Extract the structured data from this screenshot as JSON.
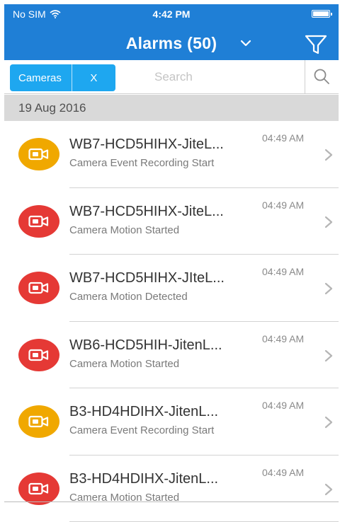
{
  "status_bar": {
    "carrier": "No SIM",
    "wifi_icon": "wifi-icon",
    "time": "4:42 PM",
    "battery_icon": "battery-icon"
  },
  "header": {
    "title": "Alarms (50)",
    "dropdown_icon": "chevron-down-icon",
    "filter_icon": "filter-funnel-icon",
    "background_color": "#1f7fd6"
  },
  "search": {
    "filter_chip_label": "Cameras",
    "filter_chip_clear": "X",
    "placeholder": "Search",
    "value": "",
    "search_icon": "search-icon",
    "chip_color": "#1ea7f0"
  },
  "date_header": "19 Aug 2016",
  "alarms": [
    {
      "title": "WB7-HCD5HIHX-JiteL...",
      "subtitle": "Camera Event Recording Start",
      "time": "04:49 AM",
      "severity": "warning",
      "icon_color": "#f0a800"
    },
    {
      "title": "WB7-HCD5HIHX-JiteL...",
      "subtitle": "Camera Motion Started",
      "time": "04:49 AM",
      "severity": "critical",
      "icon_color": "#e53935"
    },
    {
      "title": "WB7-HCD5HIHX-JIteL...",
      "subtitle": "Camera Motion Detected",
      "time": "04:49 AM",
      "severity": "critical",
      "icon_color": "#e53935"
    },
    {
      "title": "WB6-HCD5HIH-JitenL...",
      "subtitle": "Camera Motion Started",
      "time": "04:49 AM",
      "severity": "critical",
      "icon_color": "#e53935"
    },
    {
      "title": "B3-HD4HDIHX-JitenL...",
      "subtitle": "Camera Event Recording Start",
      "time": "04:49 AM",
      "severity": "warning",
      "icon_color": "#f0a800"
    },
    {
      "title": "B3-HD4HDIHX-JitenL...",
      "subtitle": "Camera Motion Started",
      "time": "04:49 AM",
      "severity": "critical",
      "icon_color": "#e53935"
    }
  ]
}
